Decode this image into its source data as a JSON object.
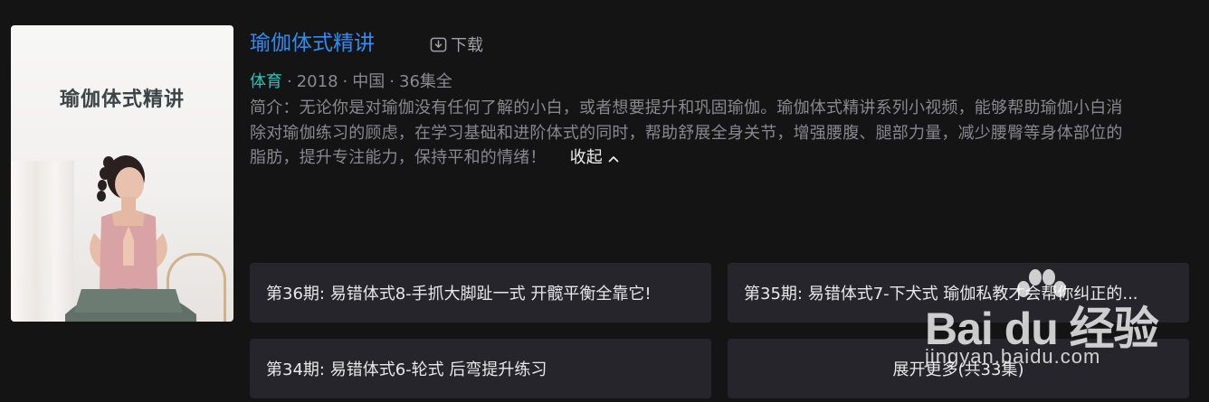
{
  "poster": {
    "title": "瑜伽体式精讲",
    "image_alt": "yoga-instructor-photo"
  },
  "header": {
    "title": "瑜伽体式精讲",
    "download_label": "下载",
    "download_icon": "download-icon"
  },
  "meta": {
    "genre": "体育",
    "year": "2018",
    "region": "中国",
    "episodes": "36集全",
    "separator": "·"
  },
  "description": {
    "line1": "简介：无论你是对瑜伽没有任何了解的小白，或者想要提升和巩固瑜伽。瑜伽体式精讲系列小视频，能够帮助瑜伽小白消",
    "line2": "除对瑜伽练习的顾虑，在学习基础和进阶体式的同时，帮助舒展全身关节，增强腰腹、腿部力量，减少腰臀等身体部位的",
    "line3": "脂肪，提升专注能力，保持平和的情绪！",
    "collapse_label": "收起",
    "collapse_icon": "chevron-up-icon"
  },
  "episodes": [
    {
      "label": "第36期: 易错体式8-手抓大脚趾一式 开髋平衡全靠它!"
    },
    {
      "label": "第35期: 易错体式7-下犬式 瑜伽私教才会帮你纠正的..."
    },
    {
      "label": "第34期: 易错体式6-轮式 后弯提升练习"
    }
  ],
  "expand_more": "展开更多(共33集)",
  "watermark": {
    "logo": "Bai du 经验",
    "site": "jingyan.baidu.com"
  },
  "colors": {
    "background": "#141414",
    "title": "#2f8cf2",
    "genre": "#2fc3bc",
    "card": "#25252b"
  }
}
